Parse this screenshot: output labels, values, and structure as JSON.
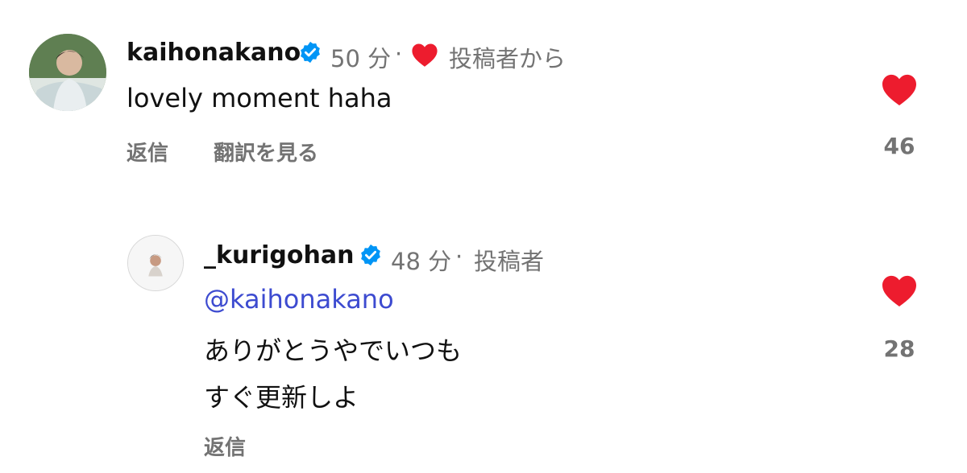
{
  "colors": {
    "heart": "#ed1c2e",
    "verified": "#0095f6",
    "mention": "#3d4bd0",
    "secondary_text": "#737373"
  },
  "comments": [
    {
      "username": "kaihonakano",
      "verified": true,
      "time": "50 分",
      "separator": "·",
      "liked_by_author": true,
      "author_label": "投稿者から",
      "text": "lovely moment haha",
      "reply_label": "返信",
      "translate_label": "翻訳を見る",
      "like_icon": "heart-filled-icon",
      "like_count": "46"
    },
    {
      "username": "_kurigohan",
      "verified": true,
      "time": "48 分",
      "separator": "·",
      "author_label": "投稿者",
      "mention": "@kaihonakano",
      "text_lines": [
        "ありがとうやでいつも",
        "すぐ更新しよ"
      ],
      "reply_label": "返信",
      "like_icon": "heart-filled-icon",
      "like_count": "28"
    }
  ]
}
